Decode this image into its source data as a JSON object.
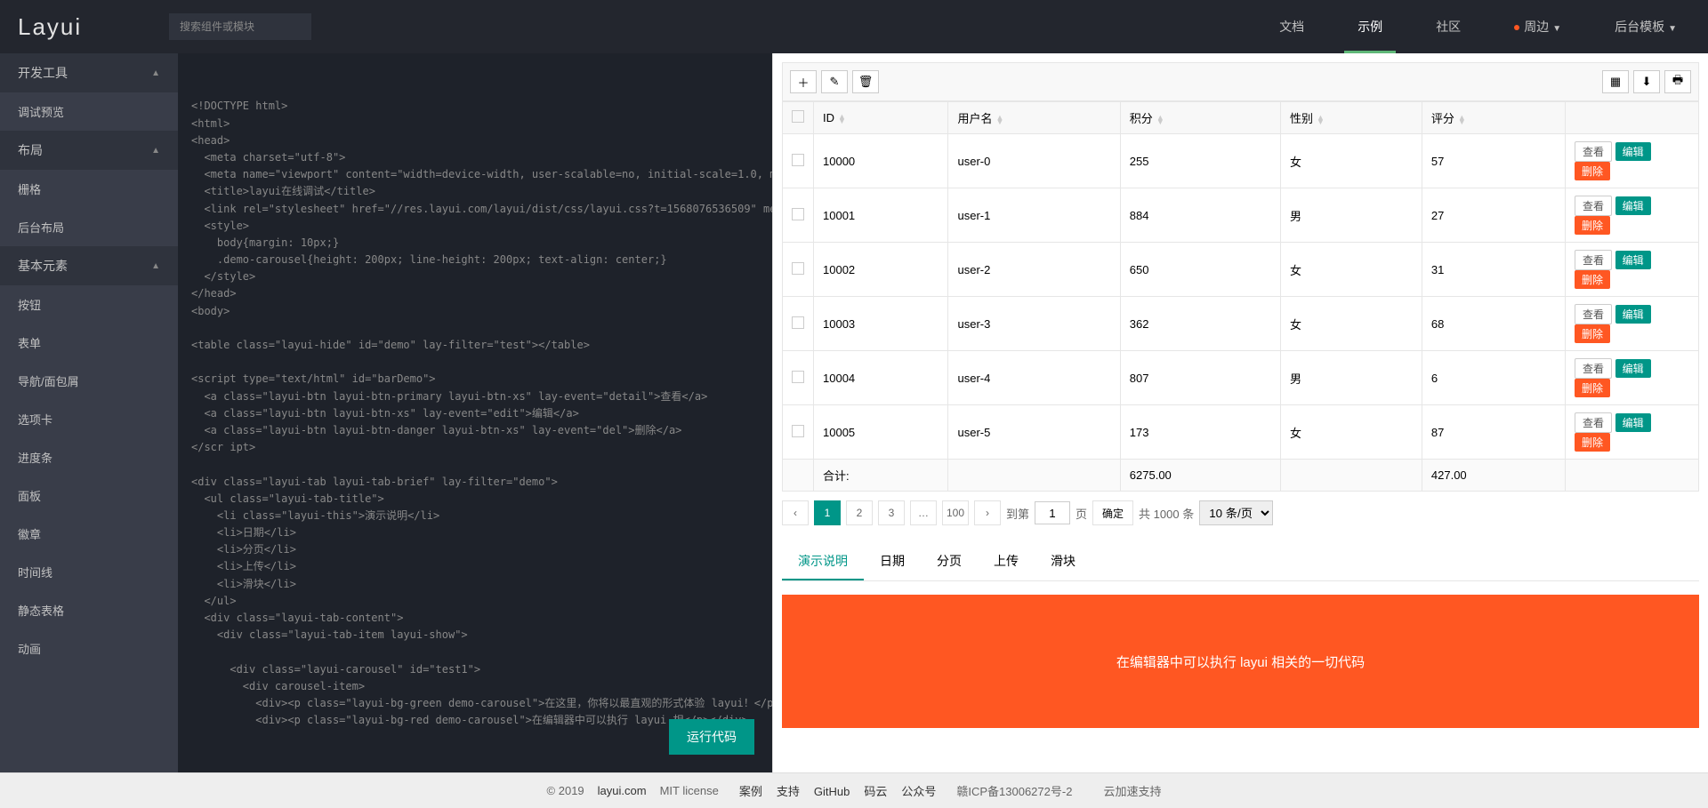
{
  "header": {
    "logo": "Layui",
    "search_placeholder": "搜索组件或模块",
    "nav": [
      {
        "label": "文档",
        "active": false
      },
      {
        "label": "示例",
        "active": true
      },
      {
        "label": "社区",
        "active": false
      },
      {
        "label": "周边",
        "active": false,
        "dot": true,
        "dropdown": true
      },
      {
        "label": "后台模板",
        "active": false,
        "dropdown": true
      }
    ]
  },
  "sidebar": [
    {
      "label": "开发工具",
      "type": "parent",
      "arrow": "up"
    },
    {
      "label": "调试预览",
      "type": "child"
    },
    {
      "label": "布局",
      "type": "parent",
      "arrow": "up"
    },
    {
      "label": "栅格",
      "type": "child"
    },
    {
      "label": "后台布局",
      "type": "child"
    },
    {
      "label": "基本元素",
      "type": "parent",
      "arrow": "up"
    },
    {
      "label": "按钮",
      "type": "child"
    },
    {
      "label": "表单",
      "type": "child"
    },
    {
      "label": "导航/面包屑",
      "type": "child"
    },
    {
      "label": "选项卡",
      "type": "child"
    },
    {
      "label": "进度条",
      "type": "child"
    },
    {
      "label": "面板",
      "type": "child"
    },
    {
      "label": "徽章",
      "type": "child"
    },
    {
      "label": "时间线",
      "type": "child"
    },
    {
      "label": "静态表格",
      "type": "child"
    },
    {
      "label": "动画",
      "type": "child"
    }
  ],
  "editor": {
    "code": "<!DOCTYPE html>\n<html>\n<head>\n  <meta charset=\"utf-8\">\n  <meta name=\"viewport\" content=\"width=device-width, user-scalable=no, initial-scale=1.0, maximum-scale=1.0, minimum-scale=1.0\">\n  <title>layui在线调试</title>\n  <link rel=\"stylesheet\" href=\"//res.layui.com/layui/dist/css/layui.css?t=1568076536509\" media=\"all\">\n  <style>\n    body{margin: 10px;}\n    .demo-carousel{height: 200px; line-height: 200px; text-align: center;}\n  </style>\n</head>\n<body>\n\n<table class=\"layui-hide\" id=\"demo\" lay-filter=\"test\"></table>\n\n<script type=\"text/html\" id=\"barDemo\">\n  <a class=\"layui-btn layui-btn-primary layui-btn-xs\" lay-event=\"detail\">查看</a>\n  <a class=\"layui-btn layui-btn-xs\" lay-event=\"edit\">编辑</a>\n  <a class=\"layui-btn layui-btn-danger layui-btn-xs\" lay-event=\"del\">删除</a>\n</scr ipt>\n\n<div class=\"layui-tab layui-tab-brief\" lay-filter=\"demo\">\n  <ul class=\"layui-tab-title\">\n    <li class=\"layui-this\">演示说明</li>\n    <li>日期</li>\n    <li>分页</li>\n    <li>上传</li>\n    <li>滑块</li>\n  </ul>\n  <div class=\"layui-tab-content\">\n    <div class=\"layui-tab-item layui-show\">\n\n      <div class=\"layui-carousel\" id=\"test1\">\n        <div carousel-item>\n          <div><p class=\"layui-bg-green demo-carousel\">在这里，你将以最直观的形式体验 layui！</p></div>\n          <div><p class=\"layui-bg-red demo-carousel\">在编辑器中可以执行 layui 相</p></div>",
    "run_btn": "运行代码"
  },
  "preview": {
    "toolbar_right_titles": [
      "筛选列",
      "导出",
      "打印"
    ],
    "table": {
      "headers": [
        "ID",
        "用户名",
        "积分",
        "性别",
        "评分"
      ],
      "rows": [
        {
          "id": "10000",
          "user": "user-0",
          "score": "255",
          "sex": "女",
          "rate": "57"
        },
        {
          "id": "10001",
          "user": "user-1",
          "score": "884",
          "sex": "男",
          "rate": "27"
        },
        {
          "id": "10002",
          "user": "user-2",
          "score": "650",
          "sex": "女",
          "rate": "31"
        },
        {
          "id": "10003",
          "user": "user-3",
          "score": "362",
          "sex": "女",
          "rate": "68"
        },
        {
          "id": "10004",
          "user": "user-4",
          "score": "807",
          "sex": "男",
          "rate": "6"
        },
        {
          "id": "10005",
          "user": "user-5",
          "score": "173",
          "sex": "女",
          "rate": "87"
        }
      ],
      "totals": {
        "label": "合计:",
        "score": "6275.00",
        "rate": "427.00"
      },
      "actions": {
        "view": "查看",
        "edit": "编辑",
        "del": "删除"
      }
    },
    "pagination": {
      "pages": [
        "1",
        "2",
        "3",
        "…",
        "100"
      ],
      "goto_prefix": "到第",
      "goto_value": "1",
      "goto_suffix": "页",
      "confirm": "确定",
      "total": "共 1000 条",
      "per_page": "10 条/页"
    },
    "tabs": [
      "演示说明",
      "日期",
      "分页",
      "上传",
      "滑块"
    ],
    "carousel_text": "在编辑器中可以执行 layui 相关的一切代码"
  },
  "footer": {
    "copyright": "© 2019",
    "site": "layui.com",
    "license": "MIT license",
    "links": [
      "案例",
      "支持",
      "GitHub",
      "码云",
      "公众号"
    ],
    "icp": "赣ICP备13006272号-2",
    "accel": "云加速支持"
  }
}
